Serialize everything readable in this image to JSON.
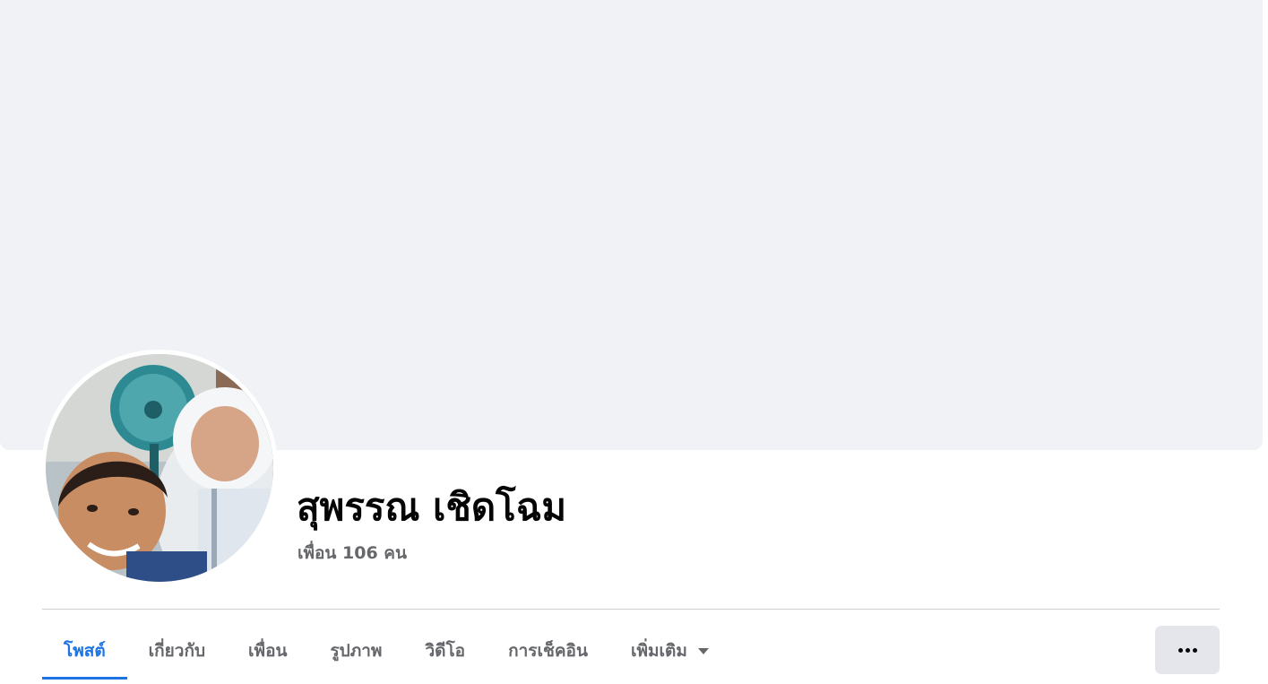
{
  "profile": {
    "name": "สุพรรณ เชิดโฉม",
    "friends_text": "เพื่อน 106 คน",
    "avatar_icon": "profile-photo"
  },
  "tabs": [
    {
      "label": "โพสต์",
      "active": true
    },
    {
      "label": "เกี่ยวกับ",
      "active": false
    },
    {
      "label": "เพื่อน",
      "active": false
    },
    {
      "label": "รูปภาพ",
      "active": false
    },
    {
      "label": "วิดีโอ",
      "active": false
    },
    {
      "label": "การเช็คอิน",
      "active": false
    },
    {
      "label": "เพิ่มเติม",
      "active": false,
      "icon": "caret-down-icon"
    }
  ],
  "actions": {
    "more_icon": "ellipsis-icon"
  },
  "colors": {
    "cover": "#f0f2f5",
    "active_tab": "#1b74e4",
    "muted_text": "#65676b",
    "button_bg": "#e4e6eb"
  }
}
